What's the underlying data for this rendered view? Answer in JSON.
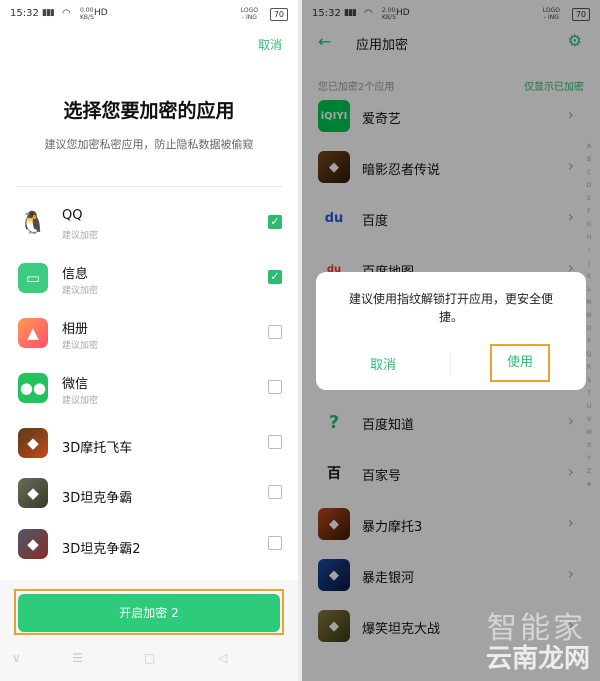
{
  "left": {
    "status": {
      "time": "15:32",
      "net_top": "0.00",
      "net_bottom": "KB/S",
      "hd": "HD",
      "logo_top": "LOGO",
      "logo_bottom": "- ING",
      "battery": "70"
    },
    "cancel_label": "取消",
    "title": "选择您要加密的应用",
    "subtitle": "建议您加密私密应用，防止隐私数据被偷窥",
    "apps": [
      {
        "name": "QQ",
        "sub": "建议加密",
        "checked": true,
        "icon": "qq-icon"
      },
      {
        "name": "信息",
        "sub": "建议加密",
        "checked": true,
        "icon": "messages-icon"
      },
      {
        "name": "相册",
        "sub": "建议加密",
        "checked": false,
        "icon": "gallery-icon"
      },
      {
        "name": "微信",
        "sub": "建议加密",
        "checked": false,
        "icon": "wechat-icon"
      },
      {
        "name": "3D摩托飞车",
        "sub": "",
        "checked": false,
        "icon": "game-icon"
      },
      {
        "name": "3D坦克争霸",
        "sub": "",
        "checked": false,
        "icon": "game-icon"
      },
      {
        "name": "3D坦克争霸2",
        "sub": "",
        "checked": false,
        "icon": "game-icon"
      }
    ],
    "start_button": "开启加密 2"
  },
  "right": {
    "status": {
      "time": "15:32",
      "net_top": "2.00",
      "net_bottom": "KB/S",
      "hd": "HD",
      "logo_top": "LOGO",
      "logo_bottom": "- ING",
      "battery": "70"
    },
    "title": "应用加密",
    "section_header": "您已加密2个应用",
    "only_encrypted": "仅显示已加密",
    "apps": [
      {
        "name": "爱奇艺",
        "icon": "iqiyi-icon"
      },
      {
        "name": "暗影忍者传说",
        "icon": "game-icon"
      },
      {
        "name": "百度",
        "icon": "baidu-icon"
      },
      {
        "name": "百度地图",
        "icon": "baidu-map-icon"
      },
      {
        "name": "",
        "icon": "app-icon"
      },
      {
        "name": "",
        "icon": "app-icon"
      },
      {
        "name": "百度知道",
        "icon": "baidu-zhidao-icon"
      },
      {
        "name": "百家号",
        "icon": "baijiahao-icon"
      },
      {
        "name": "暴力摩托3",
        "icon": "game-icon"
      },
      {
        "name": "暴走银河",
        "icon": "game-icon"
      },
      {
        "name": "爆笑坦克大战",
        "icon": "game-icon"
      }
    ],
    "index_letters": [
      "A",
      "B",
      "C",
      "D",
      "E",
      "F",
      "G",
      "H",
      "I",
      "J",
      "K",
      "L",
      "M",
      "N",
      "O",
      "P",
      "Q",
      "R",
      "S",
      "T",
      "U",
      "V",
      "W",
      "X",
      "Y",
      "Z",
      "#"
    ],
    "dialog": {
      "message": "建议使用指纹解锁打开应用，更安全便捷。",
      "cancel": "取消",
      "use": "使用"
    },
    "watermark": {
      "line1": "智能家",
      "line2": "云南龙网"
    }
  },
  "colors": {
    "accent": "#2bbd6e",
    "highlight": "#f0a030"
  }
}
